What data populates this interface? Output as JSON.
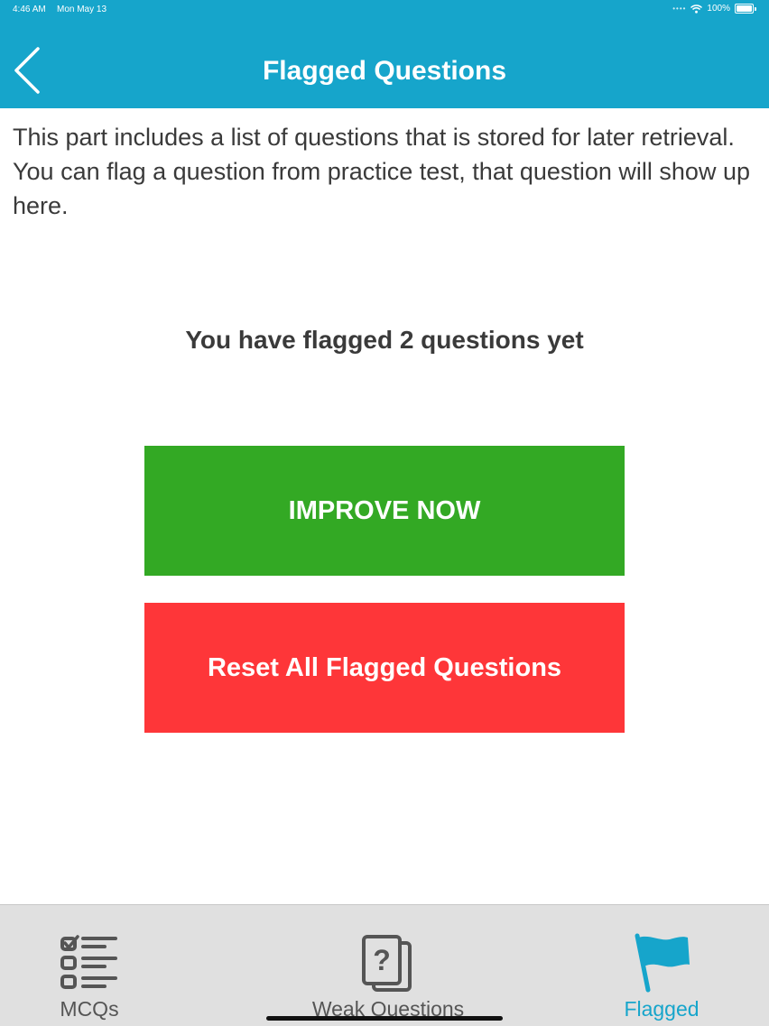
{
  "status_bar": {
    "time": "4:46 AM",
    "date": "Mon May 13",
    "battery": "100%"
  },
  "nav": {
    "title": "Flagged Questions",
    "back_icon": "chevron-left-icon"
  },
  "intro_text": "This part includes a list of questions that is stored for later retrieval. You can flag a question from practice test, that question will show up here.",
  "flag_count_text": "You have flagged 2 questions yet",
  "buttons": {
    "improve": "IMPROVE NOW",
    "reset": "Reset All Flagged Questions"
  },
  "tabs": [
    {
      "label": "MCQs",
      "icon": "checklist-icon"
    },
    {
      "label": "Weak Questions",
      "icon": "question-cards-icon"
    },
    {
      "label": "Flagged",
      "icon": "flag-icon",
      "active": true
    }
  ],
  "colors": {
    "header": "#16a5cb",
    "improve": "#33a924",
    "reset": "#fe3639",
    "tabbar": "#e0e0e0",
    "active_tab": "#16a5cb",
    "text": "#3a3a3a"
  }
}
